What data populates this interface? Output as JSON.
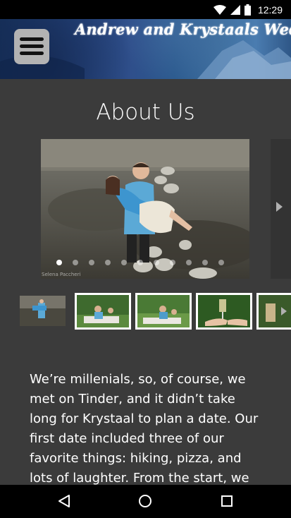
{
  "status_bar": {
    "time": "12:29",
    "icons": [
      "wifi-icon",
      "signal-icon",
      "battery-icon"
    ]
  },
  "header": {
    "title": "Andrew and Krystaals Wedding",
    "menu_icon": "hamburger-menu-icon"
  },
  "page": {
    "title": "About Us"
  },
  "carousel": {
    "slide_count": 11,
    "active_index": 0,
    "watermark": "Selena Paccheri",
    "next_icon": "chevron-right-icon"
  },
  "thumbnails": {
    "items": [
      "carry-photo",
      "picnic-photo-1",
      "picnic-photo-2",
      "champagne-toast-photo",
      "partial-photo"
    ],
    "next_icon": "chevron-right-icon"
  },
  "about": {
    "text": "We’re millenials, so, of course, we met on Tinder, and it didn’t take long for Krystaal to plan a date. Our first date included three of our favorite things: hiking, pizza, and lots of laughter. From the start, we got"
  },
  "nav_bar": {
    "icons": [
      "back-icon",
      "home-icon",
      "recents-icon"
    ]
  },
  "colors": {
    "background": "#3b3b3b",
    "header_blue": "#2f4f8b",
    "text": "#ffffff"
  }
}
